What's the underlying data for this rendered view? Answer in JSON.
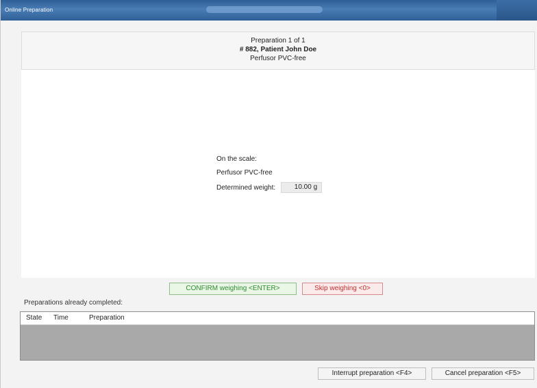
{
  "window": {
    "title": "Online Preparation"
  },
  "header": {
    "line1": "Preparation 1 of 1",
    "line2": "# 882, Patient John Doe",
    "line3": "Perfusor PVC-free"
  },
  "scale": {
    "line1": "On the scale:",
    "line2": "Perfusor PVC-free",
    "weight_label": "Determined weight:",
    "weight_value": "10.00 g"
  },
  "buttons": {
    "confirm": "CONFIRM weighing <ENTER>",
    "skip": "Skip weighing <0>",
    "interrupt": "Interrupt preparation <F4>",
    "cancel": "Cancel preparation <F5>"
  },
  "completed": {
    "label": "Preparations already completed:",
    "columns": [
      "State",
      "Time",
      "Preparation"
    ]
  },
  "colors": {
    "titlebar": "#3a6aa2",
    "confirm_text": "#2e8b2e",
    "skip_text": "#c03030",
    "table_body": "#a9a9a9"
  }
}
